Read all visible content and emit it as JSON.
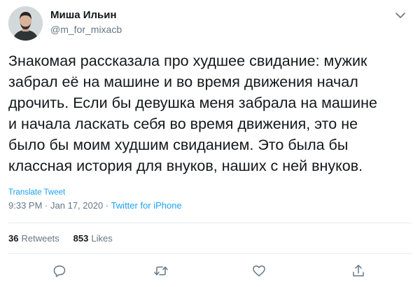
{
  "author": {
    "display_name": "Миша Ильин",
    "handle": "@m_for_mixacb"
  },
  "tweet": {
    "text": "Знакомая рассказала про худшее свидание: мужик\nзабрал её на машине и во время движения начал\nдрочить. Если бы девушка меня забрала на машине\nи начала ласкать себя во время движения, это не\nбыло бы моим худшим свиданием. Это была бы\nклассная история для внуков, наших с ней внуков.",
    "translate_label": "Translate Tweet",
    "time": "9:33 PM",
    "date": "Jan 17, 2020",
    "separator": "·",
    "source": "Twitter for iPhone"
  },
  "stats": {
    "retweets_count": "36",
    "retweets_label": "Retweets",
    "likes_count": "853",
    "likes_label": "Likes"
  },
  "icons": {
    "caret": "chevron-down-icon",
    "reply": "reply-icon",
    "retweet": "retweet-icon",
    "like": "heart-icon",
    "share": "share-icon"
  },
  "colors": {
    "accent": "#1da1f2",
    "secondary_text": "#657786",
    "primary_text": "#14171a",
    "divider": "#e6ecf0"
  }
}
